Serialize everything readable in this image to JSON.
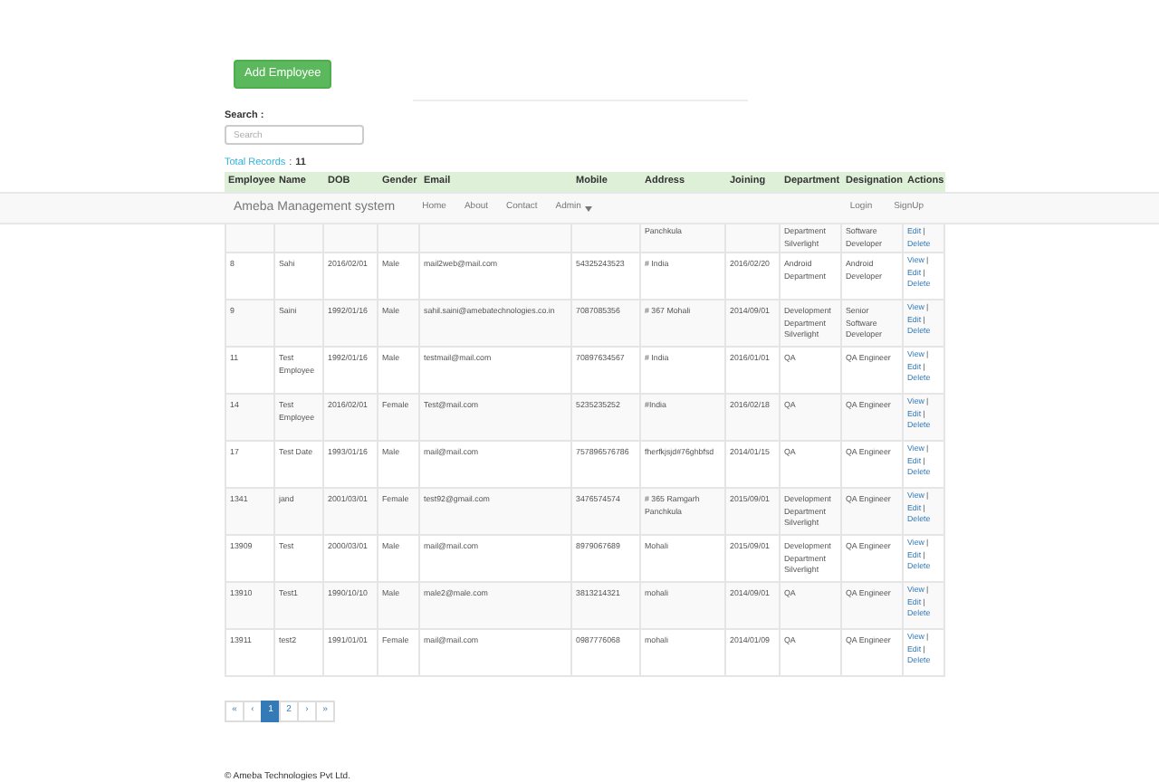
{
  "add_button": "Add Employee",
  "search": {
    "label": "Search :",
    "placeholder": "Search"
  },
  "total": {
    "label": "Total Records",
    "sep": ":",
    "count": "11"
  },
  "navbar": {
    "brand": "Ameba Management system",
    "links": [
      {
        "label": "Home",
        "caret": false
      },
      {
        "label": "About",
        "caret": false
      },
      {
        "label": "Contact",
        "caret": false
      },
      {
        "label": "Admin",
        "caret": true
      }
    ],
    "right_links": [
      "Login",
      "SignUp"
    ]
  },
  "table": {
    "columns": [
      "Employee",
      "Name",
      "DOB",
      "Gender",
      "Email",
      "Mobile",
      "Address",
      "Joining",
      "Department",
      "Designation",
      "Actions"
    ],
    "partial_row": {
      "cells": [
        "",
        "",
        "",
        "",
        "",
        "",
        "Panchkula",
        "",
        "Department Silverlight",
        "Software Developer"
      ],
      "actions": [
        {
          "label": "Edit",
          "sep": "|"
        },
        {
          "label": "Delete"
        }
      ]
    },
    "rows": [
      {
        "cells": [
          "8",
          "Sahi",
          "2016/02/01",
          "Male",
          "mail2web@mail.com",
          "54325243523",
          "# India",
          "2016/02/20",
          "Android Department",
          "Android Developer"
        ],
        "actions": [
          {
            "label": "View",
            "sep": "|"
          },
          {
            "label": "Edit",
            "sep": "|"
          },
          {
            "label": "Delete"
          }
        ]
      },
      {
        "cells": [
          "9",
          "Saini",
          "1992/01/16",
          "Male",
          "sahil.saini@amebatechnologies.co.in",
          "7087085356",
          "# 367 Mohali",
          "2014/09/01",
          "Development Department Silverlight",
          "Senior Software Developer"
        ],
        "actions": [
          {
            "label": "View",
            "sep": "|"
          },
          {
            "label": "Edit",
            "sep": "|"
          },
          {
            "label": "Delete"
          }
        ]
      },
      {
        "cells": [
          "11",
          "Test Employee",
          "1992/01/16",
          "Male",
          "testmail@mail.com",
          "70897634567",
          "# India",
          "2016/01/01",
          "QA",
          "QA Engineer"
        ],
        "actions": [
          {
            "label": "View",
            "sep": "|"
          },
          {
            "label": "Edit",
            "sep": "|"
          },
          {
            "label": "Delete"
          }
        ]
      },
      {
        "cells": [
          "14",
          "Test Employee",
          "2016/02/01",
          "Female",
          "Test@mail.com",
          "5235235252",
          "#India",
          "2016/02/18",
          "QA",
          "QA Engineer"
        ],
        "actions": [
          {
            "label": "View",
            "sep": "|"
          },
          {
            "label": "Edit",
            "sep": "|"
          },
          {
            "label": "Delete"
          }
        ]
      },
      {
        "cells": [
          "17",
          "Test Date",
          "1993/01/16",
          "Male",
          "mail@mail.com",
          "757896576786",
          "fherfkjsjd#76ghbfsd",
          "2014/01/15",
          "QA",
          "QA Engineer"
        ],
        "actions": [
          {
            "label": "View",
            "sep": "|"
          },
          {
            "label": "Edit",
            "sep": "|"
          },
          {
            "label": "Delete"
          }
        ]
      },
      {
        "cells": [
          "1341",
          "jand",
          "2001/03/01",
          "Female",
          "test92@gmail.com",
          "3476574574",
          "# 365 Ramgarh Panchkula",
          "2015/09/01",
          "Development Department Silverlight",
          "QA Engineer"
        ],
        "actions": [
          {
            "label": "View",
            "sep": "|"
          },
          {
            "label": "Edit",
            "sep": "|"
          },
          {
            "label": "Delete"
          }
        ]
      },
      {
        "cells": [
          "13909",
          "Test",
          "2000/03/01",
          "Male",
          "mail@mail.com",
          "8979067689",
          "Mohali",
          "2015/09/01",
          "Development Department Silverlight",
          "QA Engineer"
        ],
        "actions": [
          {
            "label": "View",
            "sep": "|"
          },
          {
            "label": "Edit",
            "sep": "|"
          },
          {
            "label": "Delete"
          }
        ]
      },
      {
        "cells": [
          "13910",
          "Test1",
          "1990/10/10",
          "Male",
          "male2@male.com",
          "3813214321",
          "mohali",
          "2014/09/01",
          "QA",
          "QA Engineer"
        ],
        "actions": [
          {
            "label": "View",
            "sep": "|"
          },
          {
            "label": "Edit",
            "sep": "|"
          },
          {
            "label": "Delete"
          }
        ]
      },
      {
        "cells": [
          "13911",
          "test2",
          "1991/01/01",
          "Female",
          "mail@mail.com",
          "0987776068",
          "mohali",
          "2014/01/09",
          "QA",
          "QA Engineer"
        ],
        "actions": [
          {
            "label": "View",
            "sep": "|"
          },
          {
            "label": "Edit",
            "sep": "|"
          },
          {
            "label": "Delete"
          }
        ]
      }
    ]
  },
  "pagination": [
    {
      "label": "«",
      "selected": false
    },
    {
      "label": "‹",
      "selected": false
    },
    {
      "label": "1",
      "selected": true
    },
    {
      "label": "2",
      "selected": false
    },
    {
      "label": "›",
      "selected": false
    },
    {
      "label": "»",
      "selected": false
    }
  ],
  "footer": "© Ameba Technologies Pvt Ltd."
}
